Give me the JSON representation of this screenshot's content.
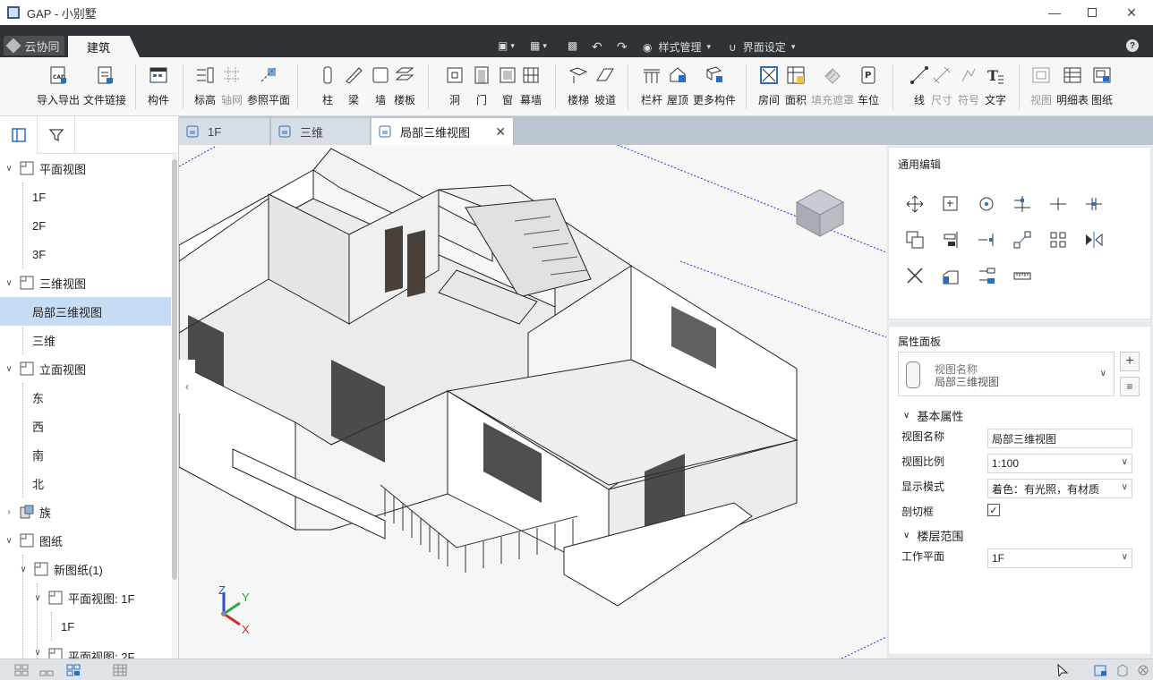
{
  "app": {
    "title": "GAP - 小别墅"
  },
  "ribbon": {
    "tabs": [
      {
        "label": "云协同"
      },
      {
        "label": "建筑"
      }
    ],
    "style_manage": "样式管理",
    "ui_settings": "界面设定"
  },
  "toolbar": {
    "import_export": "导入导出",
    "file_link": "文件链接",
    "component": "构件",
    "level": "标高",
    "grid": "轴网",
    "ref_plane": "参照平面",
    "column": "柱",
    "beam": "梁",
    "wall": "墙",
    "slab": "楼板",
    "opening": "洞",
    "door": "门",
    "window": "窗",
    "curtain_wall": "幕墙",
    "stair": "楼梯",
    "ramp": "坡道",
    "railing": "栏杆",
    "roof": "屋顶",
    "more_components": "更多构件",
    "room": "房间",
    "area": "面积",
    "fill_mask": "填充遮罩",
    "parking": "车位",
    "line": "线",
    "dimension": "尺寸",
    "symbol": "符号",
    "text": "文字",
    "view": "视图",
    "schedule": "明细表",
    "sheet": "图纸"
  },
  "tree": {
    "plan_views": "平面视图",
    "plan_1f": "1F",
    "plan_2f": "2F",
    "plan_3f": "3F",
    "views_3d": "三维视图",
    "local_3d": "局部三维视图",
    "view_3d": "三维",
    "elevations": "立面视图",
    "east": "东",
    "west": "西",
    "south": "南",
    "north": "北",
    "families": "族",
    "sheets": "图纸",
    "new_sheet": "新图纸(1)",
    "sheet_plan_1f": "平面视图: 1F",
    "sheet_1f": "1F",
    "sheet_plan_2f": "平面视图: 2F"
  },
  "doc_tabs": [
    {
      "label": "1F"
    },
    {
      "label": "三维"
    },
    {
      "label": "局部三维视图"
    }
  ],
  "right_panel": {
    "general_edit": "通用编辑",
    "property_panel": "属性面板",
    "selector_type": "视图名称",
    "selector_name": "局部三维视图",
    "basic_props": "基本属性",
    "props": [
      {
        "label": "视图名称",
        "value": "局部三维视图"
      },
      {
        "label": "视图比例",
        "value": "1:100"
      },
      {
        "label": "显示模式",
        "value": "着色：有光照，有材质"
      },
      {
        "label": "剖切框",
        "checked": true
      }
    ],
    "floor_range": "楼层范围",
    "work_plane_label": "工作平面",
    "work_plane_value": "1F"
  },
  "axes": {
    "x": "X",
    "y": "Y",
    "z": "Z"
  },
  "colors": {
    "ribbon_dark": "#2f3237",
    "selection": "#c6dcf5",
    "accent_blue": "#2a6fbf"
  }
}
